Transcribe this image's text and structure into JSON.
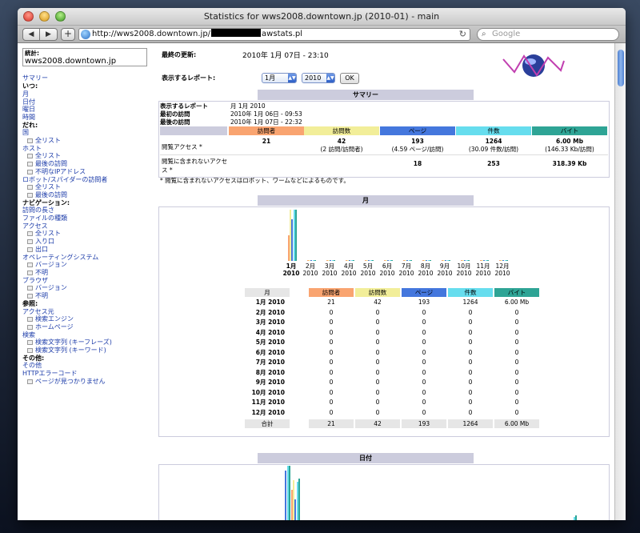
{
  "window": {
    "title": "Statistics for wws2008.downtown.jp (2010-01) - main",
    "url_prefix": "http://wws2008.downtown.jp/",
    "url_suffix": "awstats.pl",
    "search_placeholder": "Google"
  },
  "sidebar": {
    "stats_label": "統計:",
    "host": "wws2008.downtown.jp",
    "items": [
      {
        "t": "link",
        "text": "サマリー"
      },
      {
        "t": "head",
        "text": "いつ:"
      },
      {
        "t": "link",
        "text": "月"
      },
      {
        "t": "link",
        "text": "日付"
      },
      {
        "t": "link",
        "text": "曜日"
      },
      {
        "t": "link",
        "text": "時間"
      },
      {
        "t": "head",
        "text": "だれ:"
      },
      {
        "t": "link",
        "text": "国"
      },
      {
        "t": "sub",
        "text": "全リスト"
      },
      {
        "t": "link",
        "text": "ホスト"
      },
      {
        "t": "sub",
        "text": "全リスト"
      },
      {
        "t": "sub",
        "text": "最後の訪問"
      },
      {
        "t": "sub",
        "text": "不明なIPアドレス"
      },
      {
        "t": "link",
        "text": "ロボット/スパイダーの訪問者"
      },
      {
        "t": "sub",
        "text": "全リスト"
      },
      {
        "t": "sub",
        "text": "最後の訪問"
      },
      {
        "t": "head",
        "text": "ナビゲーション:"
      },
      {
        "t": "link",
        "text": "訪問の長さ"
      },
      {
        "t": "link",
        "text": "ファイルの種類"
      },
      {
        "t": "link",
        "text": "アクセス"
      },
      {
        "t": "sub",
        "text": "全リスト"
      },
      {
        "t": "sub",
        "text": "入り口"
      },
      {
        "t": "sub",
        "text": "出口"
      },
      {
        "t": "link",
        "text": "オペレーティングシステム"
      },
      {
        "t": "sub",
        "text": "バージョン"
      },
      {
        "t": "sub",
        "text": "不明"
      },
      {
        "t": "link",
        "text": "ブラウザ"
      },
      {
        "t": "sub",
        "text": "バージョン"
      },
      {
        "t": "sub",
        "text": "不明"
      },
      {
        "t": "head",
        "text": "参照:"
      },
      {
        "t": "link",
        "text": "アクセス元"
      },
      {
        "t": "sub",
        "text": "検索エンジン"
      },
      {
        "t": "sub",
        "text": "ホームページ"
      },
      {
        "t": "link",
        "text": "検索"
      },
      {
        "t": "sub",
        "text": "検索文字列 (キーフレーズ)"
      },
      {
        "t": "sub",
        "text": "検索文字列 (キーワード)"
      },
      {
        "t": "head",
        "text": "その他:"
      },
      {
        "t": "link",
        "text": "その他"
      },
      {
        "t": "link",
        "text": "HTTPエラーコード"
      },
      {
        "t": "sub",
        "text": "ページが見つかりません"
      }
    ]
  },
  "header": {
    "last_update_label": "最終の更新:",
    "last_update_value": "2010年 1月 07日 - 23:10",
    "report_label": "表示するレポート:",
    "month_select": "1月",
    "year_select": "2010",
    "ok_label": "OK"
  },
  "summary": {
    "title": "サマリー",
    "rows_label": [
      {
        "k": "表示するレポート",
        "v": "月 1月 2010"
      },
      {
        "k": "最初の訪問",
        "v": "2010年 1月 06日 - 09:53"
      },
      {
        "k": "最後の訪問",
        "v": "2010年 1月 07日 - 22:32"
      }
    ],
    "columns": [
      "訪問者",
      "訪問数",
      "ページ",
      "件数",
      "バイト"
    ],
    "col_colors": [
      "#f9a470",
      "#f2ee99",
      "#4477dd",
      "#66ddee",
      "#2ea495"
    ],
    "viewed_label": "閲覧アクセス *",
    "viewed": [
      "21",
      "42",
      "193",
      "1264",
      "6.00 Mb"
    ],
    "viewed_sub": [
      "",
      "(2 訪問/訪問者)",
      "(4.59 ページ/訪問)",
      "(30.09 件数/訪問)",
      "(146.33 Kb/訪問)"
    ],
    "notviewed_label": "閲覧に含まれないアクセス *",
    "notviewed": [
      "",
      "",
      "18",
      "253",
      "318.39 Kb"
    ],
    "footnote": "* 閲覧に含まれないアクセスはロボット、ワームなどによるものです。"
  },
  "month_section": {
    "title": "月",
    "months": [
      "1月",
      "2月",
      "3月",
      "4月",
      "5月",
      "6月",
      "7月",
      "8月",
      "9月",
      "10月",
      "11月",
      "12月"
    ],
    "year": "2010",
    "table_header": [
      "月",
      "訪問者",
      "訪問数",
      "ページ",
      "件数",
      "バイト"
    ],
    "rows": [
      [
        "1月 2010",
        "21",
        "42",
        "193",
        "1264",
        "6.00 Mb"
      ],
      [
        "2月 2010",
        "0",
        "0",
        "0",
        "0",
        "0"
      ],
      [
        "3月 2010",
        "0",
        "0",
        "0",
        "0",
        "0"
      ],
      [
        "4月 2010",
        "0",
        "0",
        "0",
        "0",
        "0"
      ],
      [
        "5月 2010",
        "0",
        "0",
        "0",
        "0",
        "0"
      ],
      [
        "6月 2010",
        "0",
        "0",
        "0",
        "0",
        "0"
      ],
      [
        "7月 2010",
        "0",
        "0",
        "0",
        "0",
        "0"
      ],
      [
        "8月 2010",
        "0",
        "0",
        "0",
        "0",
        "0"
      ],
      [
        "9月 2010",
        "0",
        "0",
        "0",
        "0",
        "0"
      ],
      [
        "10月 2010",
        "0",
        "0",
        "0",
        "0",
        "0"
      ],
      [
        "11月 2010",
        "0",
        "0",
        "0",
        "0",
        "0"
      ],
      [
        "12月 2010",
        "0",
        "0",
        "0",
        "0",
        "0"
      ]
    ],
    "total": [
      "合計",
      "21",
      "42",
      "193",
      "1264",
      "6.00 Mb"
    ]
  },
  "day_section": {
    "title": "日付"
  }
}
